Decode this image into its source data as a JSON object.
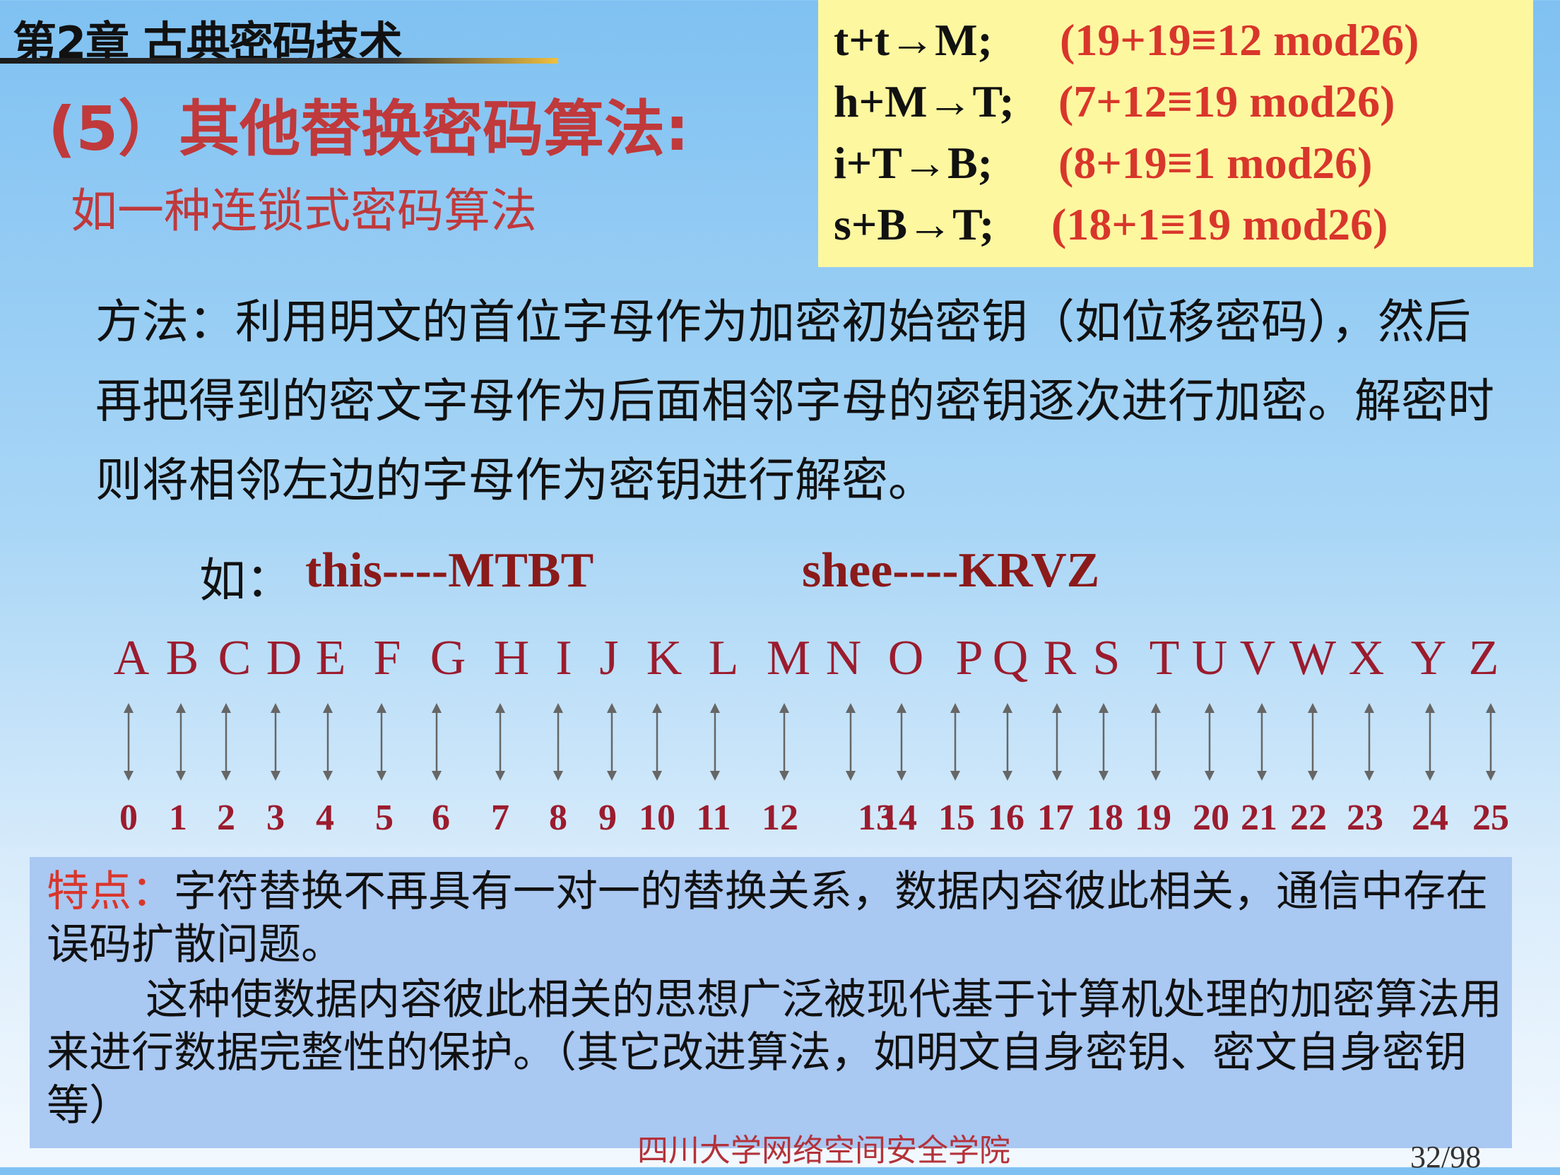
{
  "header": {
    "chapter": "第2章 古典密码技术",
    "section_title": "(5）其他替换密码算法:",
    "subtitle": "如一种连锁式密码算法"
  },
  "formulas": [
    {
      "lhs": "t+t→M;",
      "rhs": "(19+19≡12 mod26)"
    },
    {
      "lhs": "h+M→T;",
      "rhs": "(7+12≡19   mod26)"
    },
    {
      "lhs": "i+T→B;",
      "rhs": "(8+19≡1     mod26)"
    },
    {
      "lhs": "s+B→T;",
      "rhs": "(18+1≡19   mod26)"
    }
  ],
  "method_text": "方法：利用明文的首位字母作为加密初始密钥（如位移密码），然后再把得到的密文字母作为后面相邻字母的密钥逐次进行加密。解密时则将相邻左边的字母作为密钥进行解密。",
  "example": {
    "prefix": "如：",
    "ex1": "this----MTBT",
    "ex2": "shee----KRVZ"
  },
  "alphabet": {
    "letters": [
      "A",
      "B",
      "C",
      "D",
      "E",
      "F",
      "G",
      "H",
      "I",
      "J",
      "K",
      "L",
      "M",
      "N",
      "O",
      "P",
      "Q",
      "R",
      "S",
      "T",
      "U",
      "V",
      "W",
      "X",
      "Y",
      "Z"
    ],
    "numbers": [
      "0",
      "1",
      "2",
      "3",
      "4",
      "5",
      "6",
      "7",
      "8",
      "9",
      "10",
      "11",
      "12",
      "13",
      "14",
      "15",
      "16",
      "17",
      "18",
      "19",
      "20",
      "21",
      "22",
      "23",
      "24",
      "25"
    ]
  },
  "features": {
    "label": "特点：",
    "text1": "字符替换不再具有一对一的替换关系，数据内容彼此相关，通信中存在误码扩散问题。",
    "text2": "这种使数据内容彼此相关的思想广泛被现代基于计算机处理的加密算法用来进行数据完整性的保护。（其它改进算法，如明文自身密钥、密文自身密钥等）"
  },
  "footer": {
    "institution": "四川大学网络空间安全学院",
    "page": "32/98"
  },
  "colors": {
    "accent_red": "#c0393b",
    "alphabet_red": "#9b1c2e",
    "formula_box": "#fdf7a0",
    "feature_box": "#a9c8f2"
  }
}
